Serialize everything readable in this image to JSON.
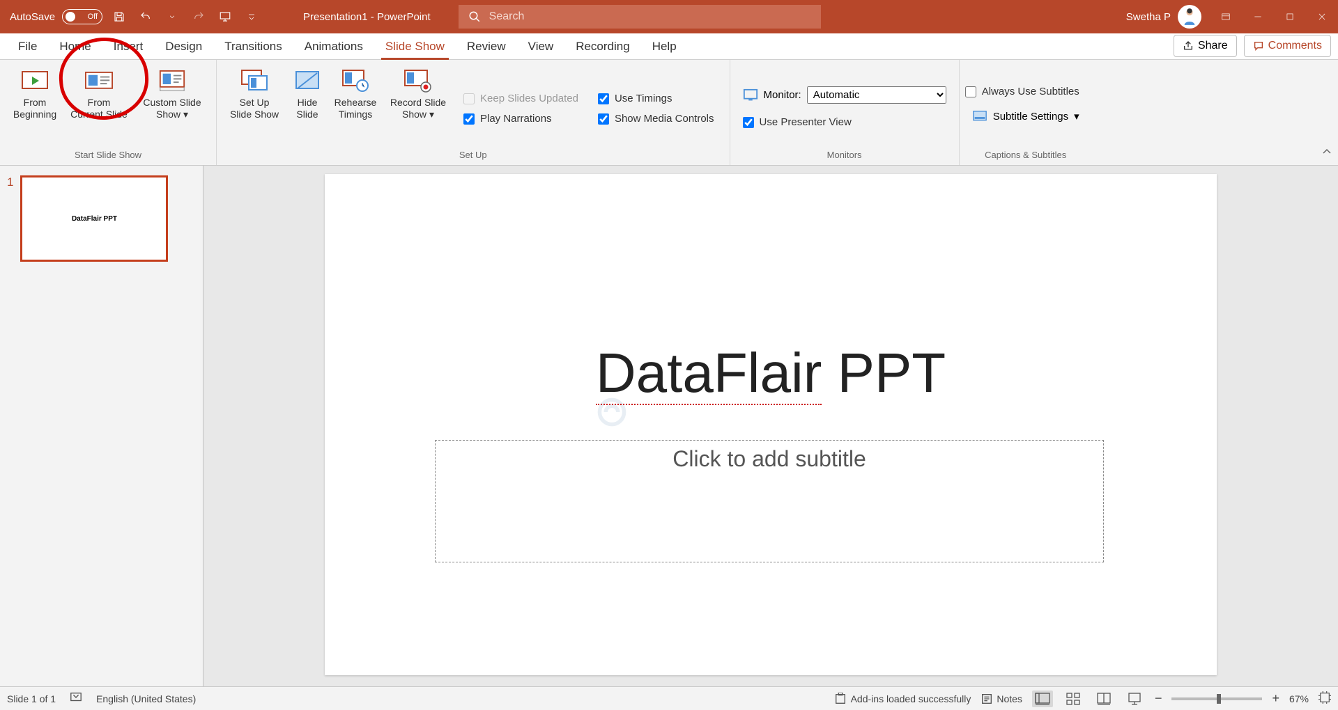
{
  "titlebar": {
    "autosave_label": "AutoSave",
    "autosave_state": "Off",
    "doc_title": "Presentation1  -  PowerPoint",
    "search_placeholder": "Search",
    "user_name": "Swetha P"
  },
  "tabs": [
    "File",
    "Home",
    "Insert",
    "Design",
    "Transitions",
    "Animations",
    "Slide Show",
    "Review",
    "View",
    "Recording",
    "Help"
  ],
  "active_tab": "Slide Show",
  "share_label": "Share",
  "comments_label": "Comments",
  "ribbon": {
    "start_group": {
      "label": "Start Slide Show",
      "from_beginning": "From\nBeginning",
      "from_current": "From\nCurrent Slide",
      "custom_show": "Custom Slide\nShow"
    },
    "setup_group": {
      "label": "Set Up",
      "set_up": "Set Up\nSlide Show",
      "hide_slide": "Hide\nSlide",
      "rehearse": "Rehearse\nTimings",
      "record": "Record Slide\nShow",
      "keep_updated": "Keep Slides Updated",
      "use_timings": "Use Timings",
      "play_narrations": "Play Narrations",
      "show_media": "Show Media Controls"
    },
    "monitors_group": {
      "label": "Monitors",
      "monitor_label": "Monitor:",
      "monitor_value": "Automatic",
      "presenter_view": "Use Presenter View"
    },
    "captions_group": {
      "label": "Captions & Subtitles",
      "always_use": "Always Use Subtitles",
      "subtitle_settings": "Subtitle Settings"
    }
  },
  "thumb": {
    "num": "1",
    "text": "DataFlair PPT"
  },
  "slide": {
    "title_part1": "DataFlair",
    "title_part2": " PPT",
    "subtitle_placeholder": "Click to add subtitle"
  },
  "statusbar": {
    "slide_info": "Slide 1 of 1",
    "language": "English (United States)",
    "addins_msg": "Add-ins loaded successfully",
    "notes_label": "Notes",
    "zoom_pct": "67%"
  }
}
